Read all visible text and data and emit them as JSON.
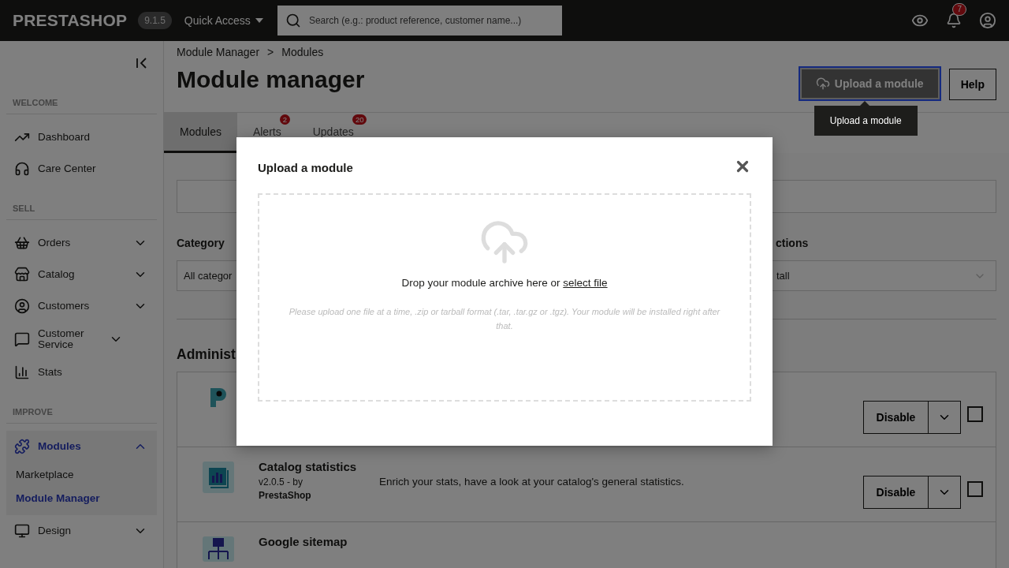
{
  "topbar": {
    "logo": "PRESTASHOP",
    "version": "9.1.5",
    "quick_access": "Quick Access",
    "search_placeholder": "Search (e.g.: product reference, customer name...)",
    "notifications": "7"
  },
  "sidebar": {
    "sections": [
      {
        "label": "WELCOME",
        "items": [
          {
            "label": "Dashboard",
            "selected": false
          },
          {
            "label": "Care Center",
            "selected": false
          }
        ]
      },
      {
        "label": "SELL",
        "items": [
          {
            "label": "Orders",
            "expanded": false,
            "selected": false
          },
          {
            "label": "Catalog",
            "expanded": false,
            "selected": false
          },
          {
            "label": "Customers",
            "expanded": false,
            "selected": false
          },
          {
            "label": "Customer Service",
            "expanded": false,
            "selected": false
          },
          {
            "label": "Stats",
            "selected": false
          }
        ]
      },
      {
        "label": "IMPROVE",
        "items": [
          {
            "label": "Modules",
            "expanded": true,
            "selected": true,
            "children": [
              {
                "label": "Marketplace",
                "selected": false
              },
              {
                "label": "Module Manager",
                "selected": true
              }
            ]
          },
          {
            "label": "Design",
            "expanded": false,
            "selected": false
          }
        ]
      }
    ]
  },
  "header": {
    "breadcrumb": [
      "Module Manager",
      "Modules"
    ],
    "breadcrumb_separator": ">",
    "title": "Module manager",
    "upload_button": "Upload a module",
    "help_button": "Help",
    "tooltip": "Upload a module"
  },
  "tabs": [
    {
      "label": "Modules",
      "selected": true
    },
    {
      "label": "Alerts",
      "badge": "2",
      "selected": false
    },
    {
      "label": "Updates",
      "badge": "20",
      "selected": false
    }
  ],
  "filters": {
    "category_label": "Category",
    "category_value": "All categor",
    "actions_label": "ctions",
    "actions_value": "tall"
  },
  "section_heading": "Administ",
  "modules": [
    {
      "action": "Disable",
      "checked": false
    },
    {
      "name": "Catalog statistics",
      "version": "v2.0.5 - by",
      "author": "PrestaShop",
      "description": "Enrich your stats, have a look at your catalog's general statistics.",
      "action": "Disable",
      "checked": false
    },
    {
      "name": "Google sitemap"
    }
  ],
  "modal": {
    "title": "Upload a module",
    "drop_text": "Drop your module archive here or",
    "link": "select file",
    "hint": "Please upload one file at a time, .zip or tarball format (.tar, .tar.gz or .tgz). Your module will be installed right after that."
  }
}
